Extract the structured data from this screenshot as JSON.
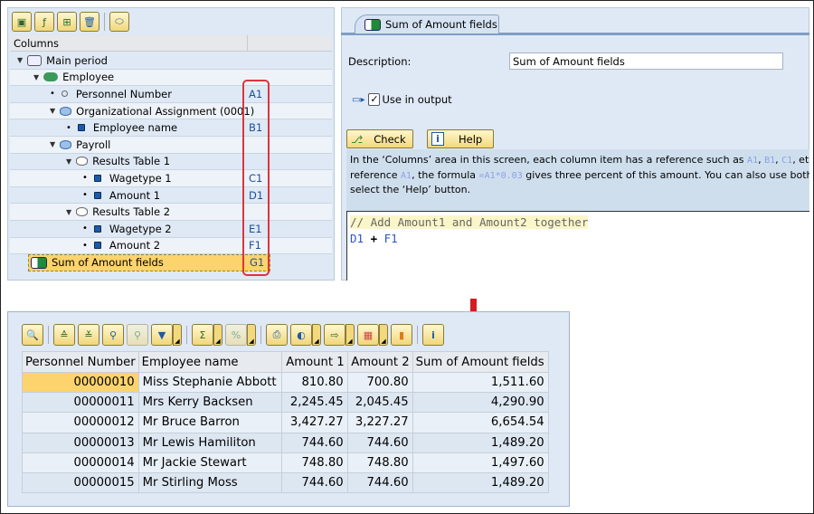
{
  "tree": {
    "toolbar_icons": [
      "add-column-icon",
      "add-formula-icon",
      "period-icon",
      "delete-icon",
      "database-icon"
    ],
    "header": "Columns",
    "rows": [
      {
        "label": "Main period",
        "ref": "",
        "icon": "period-icon"
      },
      {
        "label": "Employee",
        "ref": "",
        "icon": "employee-group-icon"
      },
      {
        "label": "Personnel Number",
        "ref": "A1",
        "icon": "field-circle-icon"
      },
      {
        "label": "Organizational Assignment (0001)",
        "ref": "",
        "icon": "infotype-icon"
      },
      {
        "label": "Employee name",
        "ref": "B1",
        "icon": "field-icon"
      },
      {
        "label": "Payroll",
        "ref": "",
        "icon": "infotype-icon"
      },
      {
        "label": "Results Table 1",
        "ref": "",
        "icon": "table-icon"
      },
      {
        "label": "Wagetype 1",
        "ref": "C1",
        "icon": "field-icon"
      },
      {
        "label": "Amount 1",
        "ref": "D1",
        "icon": "field-icon"
      },
      {
        "label": "Results Table 2",
        "ref": "",
        "icon": "table-icon"
      },
      {
        "label": "Wagetype 2",
        "ref": "E1",
        "icon": "field-icon"
      },
      {
        "label": "Amount 2",
        "ref": "F1",
        "icon": "field-icon"
      },
      {
        "label": "Sum of Amount fields",
        "ref": "G1",
        "icon": "formula-icon"
      }
    ]
  },
  "form": {
    "tab_label": "Sum of Amount fields",
    "description_label": "Description:",
    "description_value": "Sum of Amount fields",
    "use_in_output_label": "Use in output",
    "use_in_output_checked": true,
    "check_label": "Check",
    "help_label": "Help",
    "info": {
      "l1a": "In the ‘Columns’ area in this screen, each column item has a reference such as ",
      "r1": "A1",
      "c1": ", ",
      "r2": "B1",
      "c2": ", ",
      "r3": "C1",
      "l1b": ", etc.",
      "l2a": "reference ",
      "r4": "A1",
      "l2b": ", the formula ",
      "f1": "=A1*0.03",
      "l2c": " gives three percent of this amount. You can also use both",
      "l3": "select the ‘Help’ button."
    },
    "editor": {
      "comment": "// Add Amount1 and Amount2 together",
      "ref1": "D1",
      "op": " + ",
      "ref2": "F1"
    }
  },
  "alv": {
    "columns": [
      "Personnel Number",
      "Employee name",
      "Amount 1",
      "Amount 2",
      "Sum of Amount fields"
    ],
    "rows": [
      [
        "00000010",
        "Miss Stephanie Abbott",
        "810.80",
        "700.80",
        "1,511.60"
      ],
      [
        "00000011",
        "Mrs Kerry Backsen",
        "2,245.45",
        "2,045.45",
        "4,290.90"
      ],
      [
        "00000012",
        "Mr Bruce Barron",
        "3,427.27",
        "3,227.27",
        "6,654.54"
      ],
      [
        "00000013",
        "Mr Lewis Hamiliton",
        "744.60",
        "744.60",
        "1,489.20"
      ],
      [
        "00000014",
        "Mr Jackie Stewart",
        "748.80",
        "748.80",
        "1,497.60"
      ],
      [
        "00000015",
        "Mr Stirling Moss",
        "744.60",
        "744.60",
        "1,489.20"
      ]
    ]
  },
  "colors": {
    "highlight": "#fcd36c",
    "annotation_red": "#d41c22",
    "ref_blue": "#1c4e9a"
  }
}
